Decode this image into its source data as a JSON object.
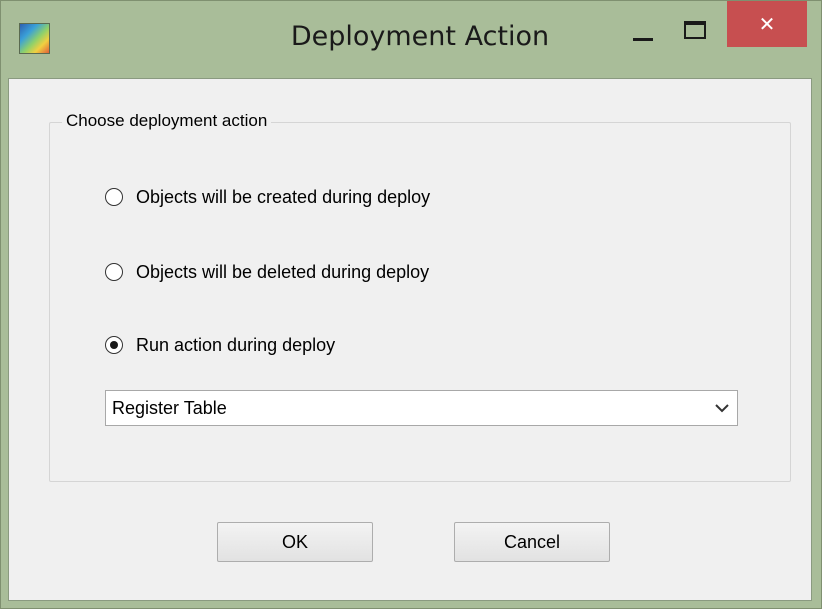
{
  "window": {
    "title": "Deployment Action",
    "icon": "app-icon",
    "controls": {
      "minimize": "minimize-icon",
      "maximize": "maximize-icon",
      "close": "close-icon",
      "close_glyph": "✕"
    }
  },
  "group": {
    "legend": "Choose deployment action",
    "options": [
      {
        "label": "Objects will be created during deploy",
        "selected": false
      },
      {
        "label": "Objects will be deleted during deploy",
        "selected": false
      },
      {
        "label": "Run action during deploy",
        "selected": true
      }
    ],
    "action_select": {
      "value": "Register Table",
      "icon": "chevron-down-icon"
    }
  },
  "buttons": {
    "ok": "OK",
    "cancel": "Cancel"
  },
  "colors": {
    "frame": "#a9bd99",
    "close": "#c74f50",
    "client": "#f0f0f0"
  }
}
